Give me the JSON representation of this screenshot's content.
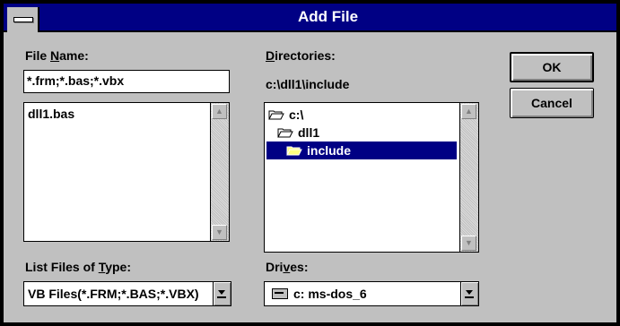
{
  "window": {
    "title": "Add File"
  },
  "file_name": {
    "label_pre": "File ",
    "label_ul": "N",
    "label_post": "ame:",
    "value": "*.frm;*.bas;*.vbx",
    "files": [
      "dll1.bas"
    ]
  },
  "directories": {
    "label_ul": "D",
    "label_post": "irectories:",
    "current_path": "c:\\dll1\\include",
    "items": [
      "c:\\",
      "dll1",
      "include"
    ],
    "selected": "include"
  },
  "type": {
    "label_pre": "List Files of ",
    "label_ul": "T",
    "label_post": "ype:",
    "value": "VB Files(*.FRM;*.BAS;*.VBX)"
  },
  "drives": {
    "label_pre": "Dri",
    "label_ul": "v",
    "label_post": "es:",
    "value": "c: ms-dos_6"
  },
  "buttons": {
    "ok": "OK",
    "cancel": "Cancel"
  },
  "colors": {
    "titlebar": "#000084",
    "face": "#c0c0c0",
    "selection": "#000084"
  }
}
